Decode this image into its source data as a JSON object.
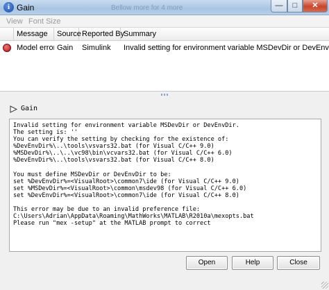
{
  "window": {
    "title": "Gain",
    "background_ghost_text": "Bellow  more  for  4  more",
    "controls": {
      "minimize": "—",
      "maximize": "□",
      "close": "✕"
    }
  },
  "menubar": {
    "items": [
      "View",
      "Font Size"
    ]
  },
  "table": {
    "columns": [
      "Message",
      "Source",
      "Reported By",
      "Summary"
    ],
    "rows": [
      {
        "icon": "error-icon",
        "message": "Model error",
        "source": "Gain",
        "reported_by": "Simulink",
        "summary": "Invalid setting for environment variable MSDevDir or DevEnvDir.The se"
      }
    ]
  },
  "details": {
    "header": "Gain",
    "text": "Invalid setting for environment variable MSDevDir or DevEnvDir.\nThe setting is: ''\nYou can verify the setting by checking for the existence of:\n%DevEnvDir%\\..\\tools\\vsvars32.bat (for Visual C/C++ 9.0)\n%MSDevDir%\\..\\..\\vc98\\bin\\vcvars32.bat (for Visual C/C++ 6.0)\n%DevEnvDir%\\..\\tools\\vsvars32.bat (for Visual C/C++ 8.0)\n\nYou must define MSDevDir or DevEnvDir to be:\nset %DevEnvDir%=<VisualRoot>\\common7\\ide (for Visual C/C++ 9.0)\nset %MSDevDir%=<VisualRoot>\\common\\msdev98 (for Visual C/C++ 6.0)\nset %DevEnvDir%=<VisualRoot>\\common7\\ide (for Visual C/C++ 8.0)\n\nThis error may be due to an invalid preference file:\nC:\\Users\\Adrian\\AppData\\Roaming\\MathWorks\\MATLAB\\R2010a\\mexopts.bat\nPlease run \"mex -setup\" at the MATLAB prompt to correct"
  },
  "buttons": {
    "open": "Open",
    "help": "Help",
    "close": "Close"
  },
  "colors": {
    "error": "#b01515",
    "titlebar": "#b7cfe8",
    "pane_bg": "#f0f0f0"
  }
}
